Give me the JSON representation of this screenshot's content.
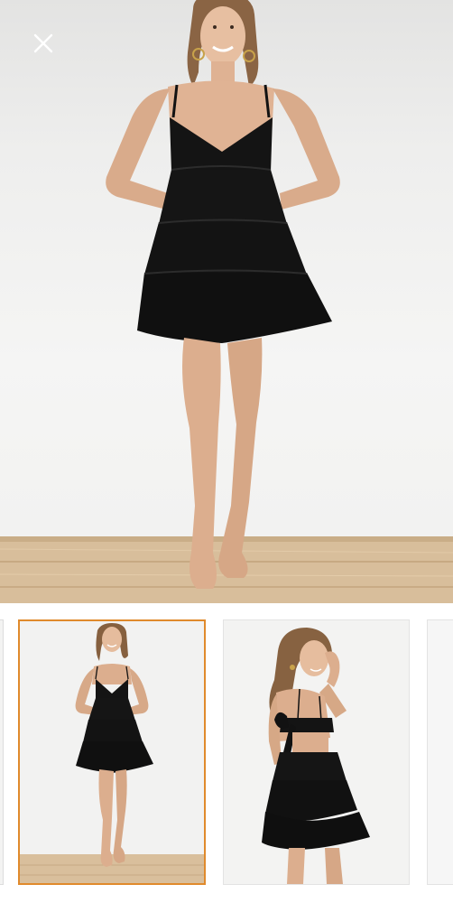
{
  "viewer": {
    "close_icon": "close-icon",
    "main_image": {
      "subject": "black-tiered-mini-dress-front",
      "colors": {
        "background": "#efefee",
        "floor": "#d9bf9c",
        "garment": "#121212"
      }
    },
    "thumbnails": [
      {
        "view": "partial-previous",
        "selected": false
      },
      {
        "view": "front",
        "selected": true
      },
      {
        "view": "back",
        "selected": false
      },
      {
        "view": "partial-next",
        "selected": false
      }
    ],
    "colors": {
      "selected_border": "#e08a2c",
      "thumb_border": "#e3e3e3"
    }
  }
}
